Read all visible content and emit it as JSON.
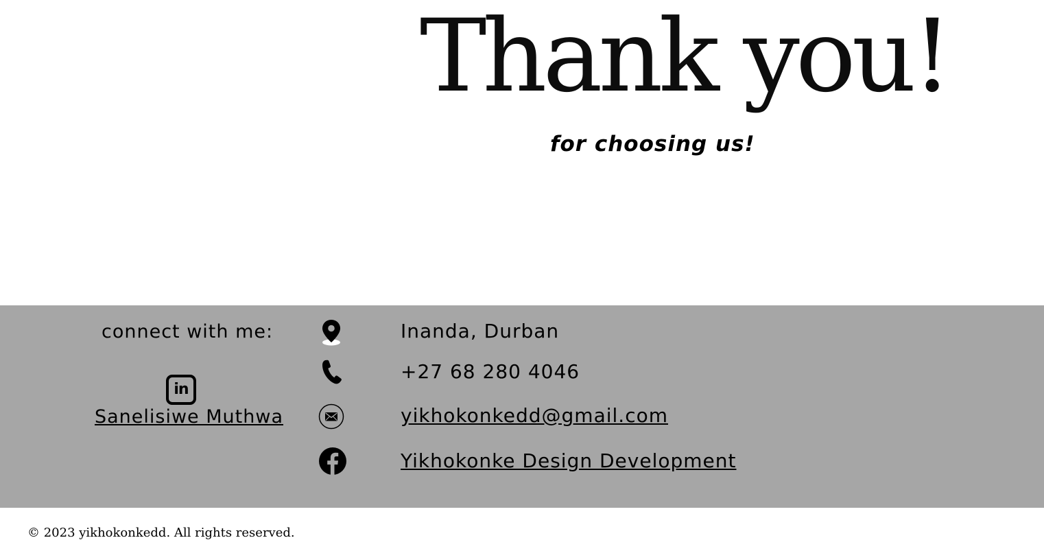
{
  "hero": {
    "title": "Thank you!",
    "subtitle": "for choosing us!"
  },
  "footer": {
    "connect_heading": "connect with me:",
    "linkedin": {
      "icon": "linkedin-icon",
      "icon_text": "in",
      "name": "Sanelisiwe Muthwa"
    },
    "contacts": {
      "location": {
        "icon": "location-pin-icon",
        "text": "Inanda, Durban"
      },
      "phone": {
        "icon": "phone-icon",
        "text": "+27 68 280 4046"
      },
      "email": {
        "icon": "envelope-icon",
        "text": "yikhokonkedd@gmail.com"
      },
      "facebook": {
        "icon": "facebook-icon",
        "text": "Yikhokonke Design Development"
      }
    },
    "background_color": "#a6a6a6"
  },
  "copyright": "© 2023 yikhokonkedd. All rights reserved."
}
